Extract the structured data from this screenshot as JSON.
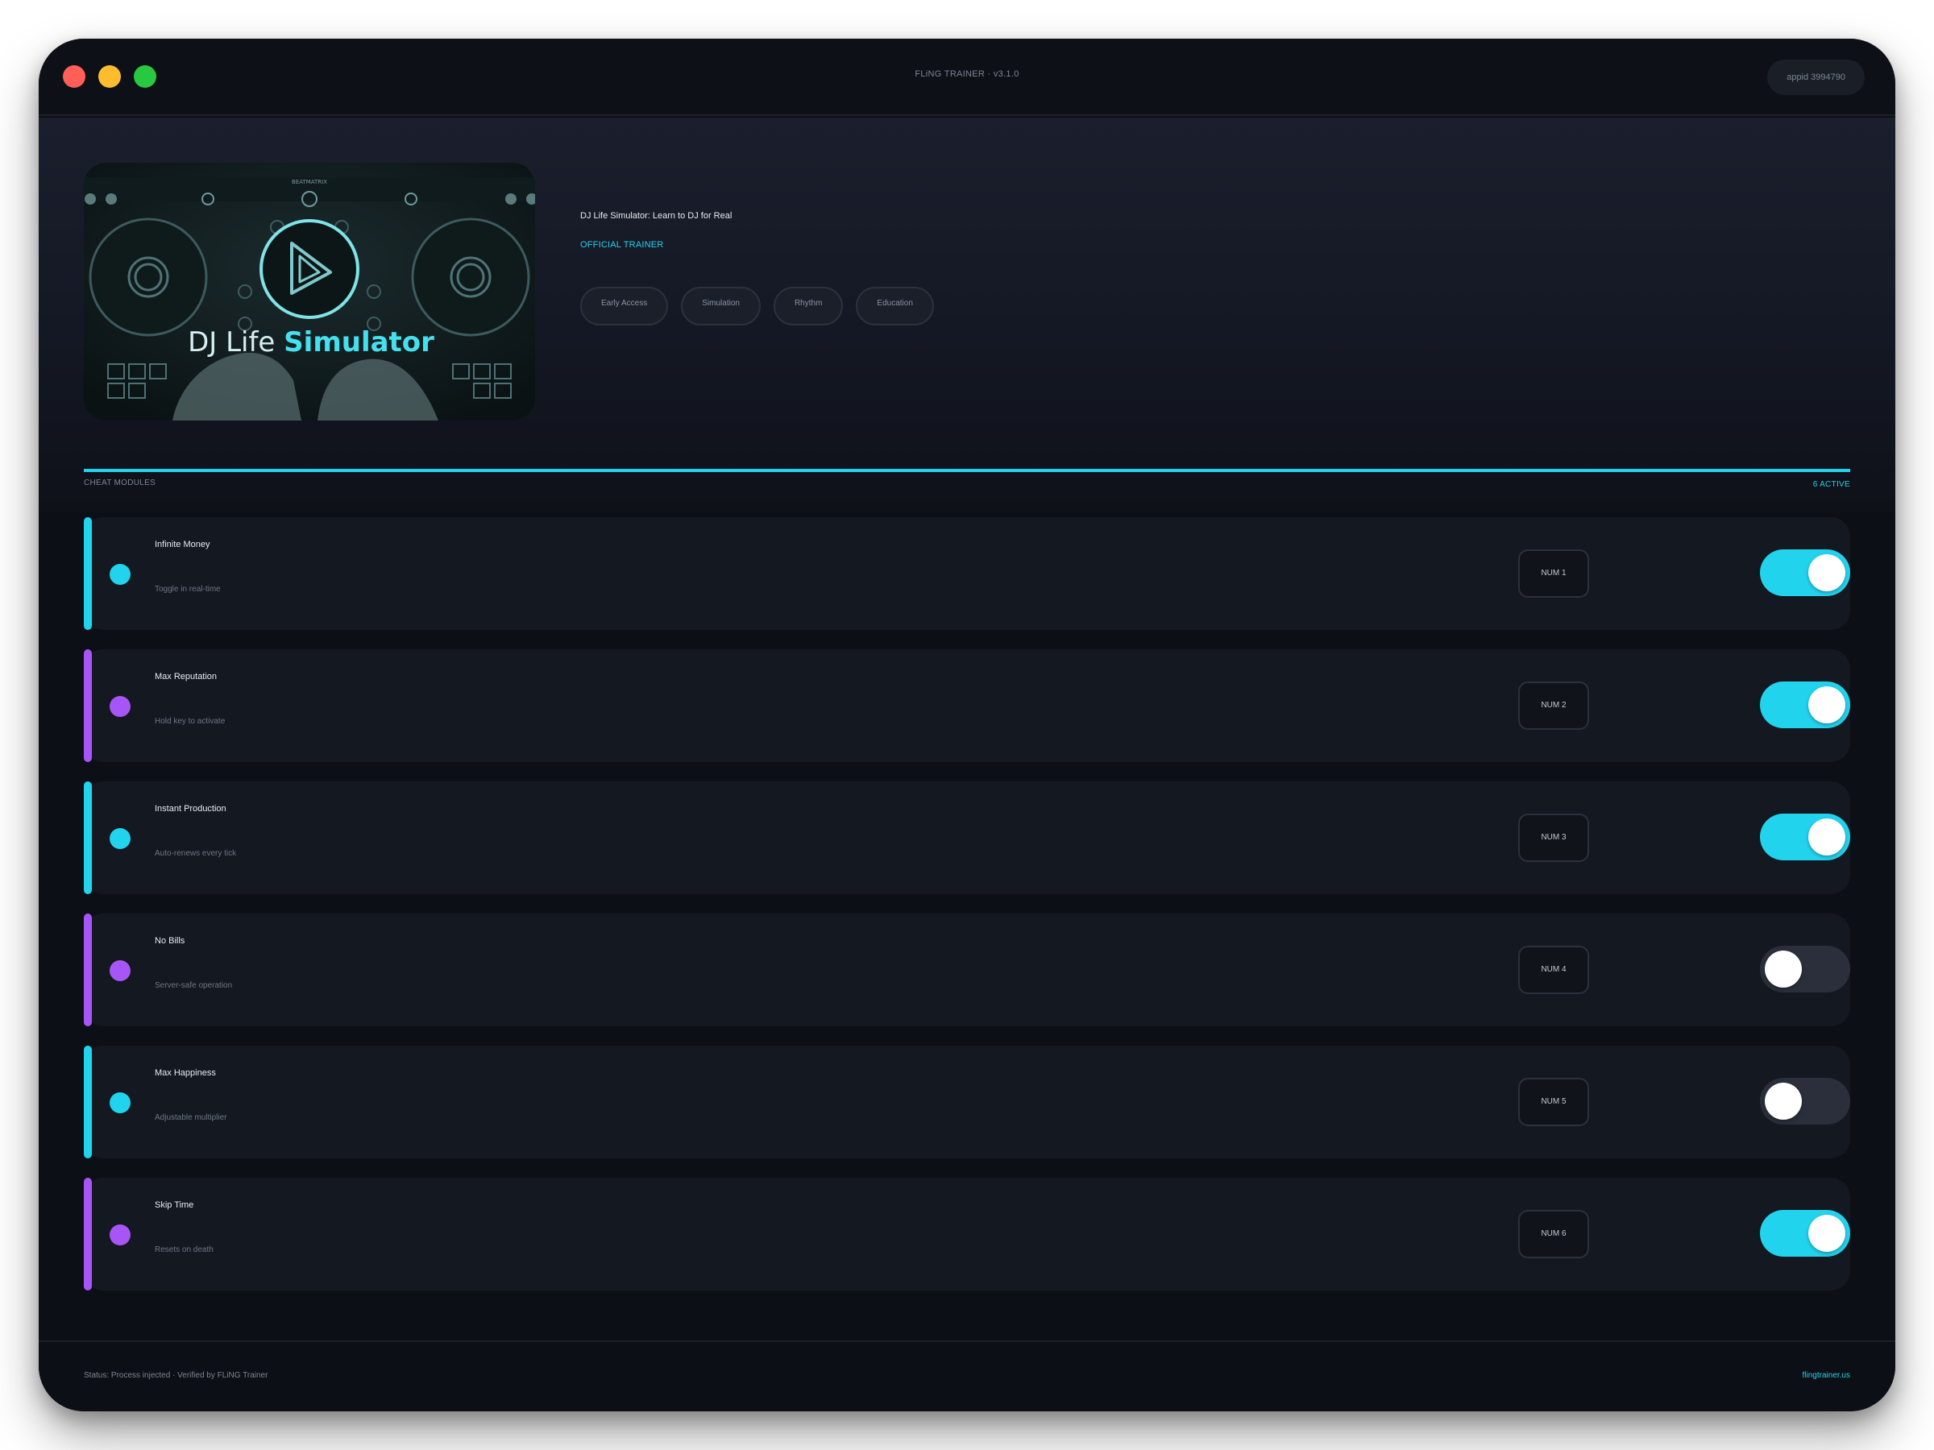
{
  "window": {
    "title": "FLiNG TRAINER · v3.1.0",
    "appid": "appid 3994790"
  },
  "game": {
    "cover_text_1": "DJ Life",
    "cover_text_2": "Simulator",
    "cover_brand": "BEATMATRIX",
    "title": "DJ Life Simulator: Learn to DJ for Real",
    "badge": "OFFICIAL TRAINER",
    "tags": [
      "Early Access",
      "Simulation",
      "Rhythm",
      "Education"
    ]
  },
  "modules": {
    "section_label": "CHEAT MODULES",
    "active_count": "6 ACTIVE",
    "items": [
      {
        "name": "Infinite Money",
        "desc": "Toggle in real-time",
        "key": "NUM 1",
        "enabled": true,
        "accent": "#22d3ee"
      },
      {
        "name": "Max Reputation",
        "desc": "Hold key to activate",
        "key": "NUM 2",
        "enabled": true,
        "accent": "#a855f7"
      },
      {
        "name": "Instant Production",
        "desc": "Auto-renews every tick",
        "key": "NUM 3",
        "enabled": true,
        "accent": "#22d3ee"
      },
      {
        "name": "No Bills",
        "desc": "Server-safe operation",
        "key": "NUM 4",
        "enabled": false,
        "accent": "#a855f7"
      },
      {
        "name": "Max Happiness",
        "desc": "Adjustable multiplier",
        "key": "NUM 5",
        "enabled": false,
        "accent": "#22d3ee"
      },
      {
        "name": "Skip Time",
        "desc": "Resets on death",
        "key": "NUM 6",
        "enabled": true,
        "accent": "#a855f7"
      }
    ]
  },
  "footer": {
    "status": "Status: Process injected · Verified by FLiNG Trainer",
    "site": "flingtrainer.us"
  },
  "colors": {
    "accent_cyan": "#22d3ee",
    "accent_purple": "#a855f7",
    "background": "#0c0f15"
  }
}
